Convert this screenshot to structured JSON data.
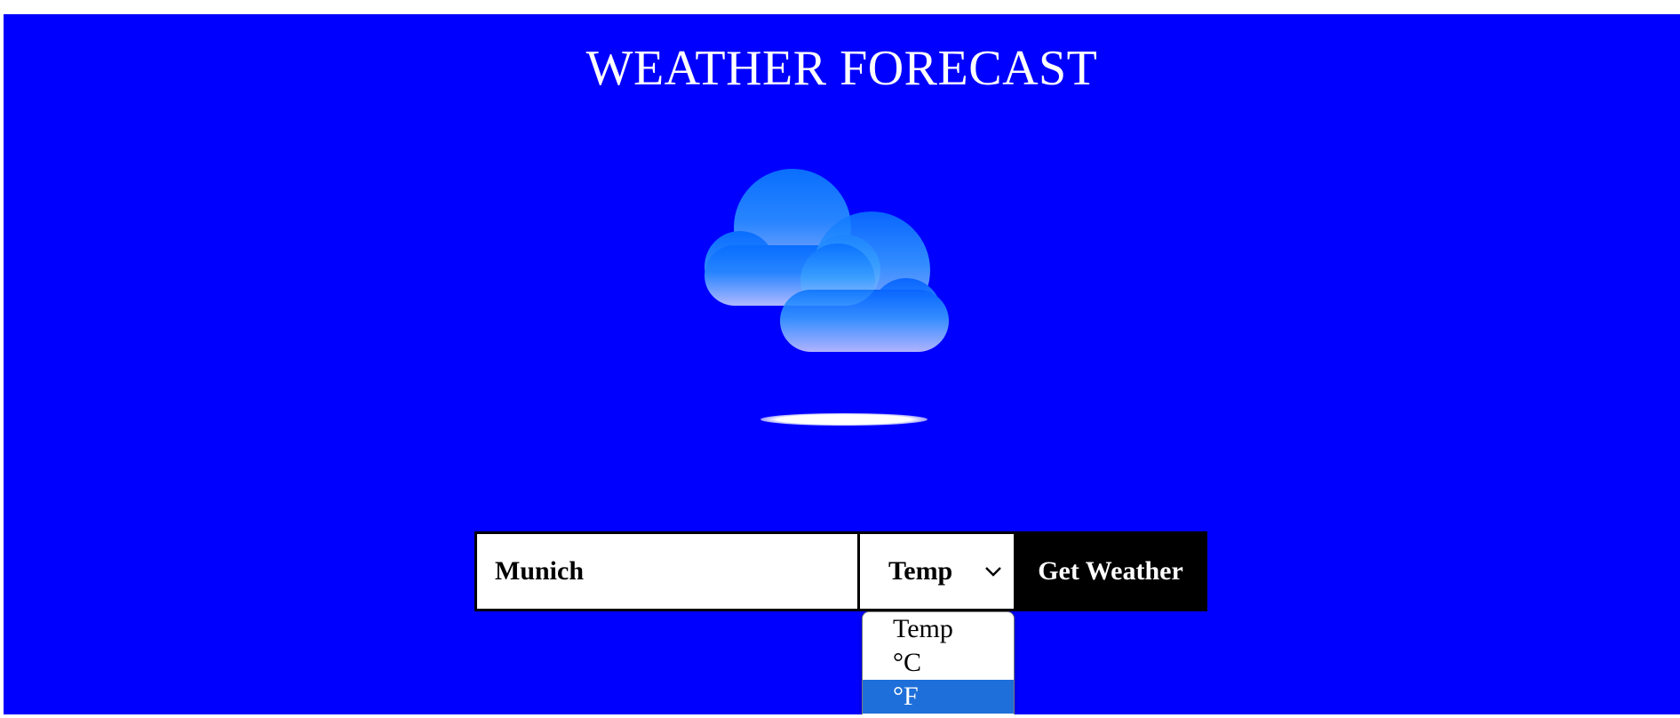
{
  "header": {
    "title": "WEATHER FORECAST"
  },
  "weather_icon": {
    "name": "cloudy-icon"
  },
  "form": {
    "city_value": "Munich",
    "unit_selected": "Temp",
    "submit_label": "Get Weather"
  },
  "dropdown": {
    "options": [
      {
        "label": "Temp"
      },
      {
        "label": "°C"
      },
      {
        "label": "°F"
      }
    ],
    "highlighted": "°F"
  },
  "colors": {
    "background": "#0000ff",
    "button": "#000000",
    "highlight": "#1e6fd9"
  }
}
